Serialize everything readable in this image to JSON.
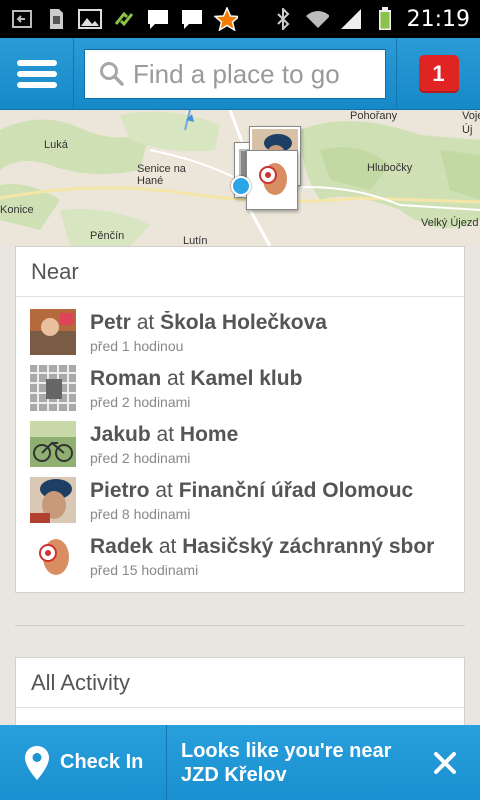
{
  "status_bar": {
    "time": "21:19",
    "icons": [
      "back-icon",
      "sim-icon",
      "image-icon",
      "sync-icon",
      "chat-icon",
      "chat-icon",
      "star-icon",
      "bluetooth-icon",
      "wifi-icon",
      "signal-icon",
      "battery-icon"
    ]
  },
  "header": {
    "search_placeholder": "Find a place to go",
    "notification_count": "1"
  },
  "map": {
    "labels": [
      "Luká",
      "Senice na Hané",
      "Konice",
      "Pěnčín",
      "Lutín",
      "Pohořany",
      "Hlubočky",
      "Velký Újezd",
      "Voje",
      "Új"
    ]
  },
  "near": {
    "title": "Near",
    "connector": "at",
    "items": [
      {
        "name": "Petr",
        "place": "Škola Holečkova",
        "time": "před 1 hodinou"
      },
      {
        "name": "Roman",
        "place": "Kamel klub",
        "time": "před 2 hodinami"
      },
      {
        "name": "Jakub",
        "place": "Home",
        "time": "před 2 hodinami"
      },
      {
        "name": "Pietro",
        "place": "Finanční úřad Olomouc",
        "time": "před 8 hodinami"
      },
      {
        "name": "Radek",
        "place": "Hasičský záchranný sbor",
        "time": "před 15 hodinami"
      }
    ]
  },
  "all_activity": {
    "title": "All Activity"
  },
  "bottom_bar": {
    "checkin_label": "Check In",
    "near_message": "Looks like you're near JZD Křelov"
  },
  "colors": {
    "accent": "#1a8fcf",
    "badge": "#e02424"
  }
}
